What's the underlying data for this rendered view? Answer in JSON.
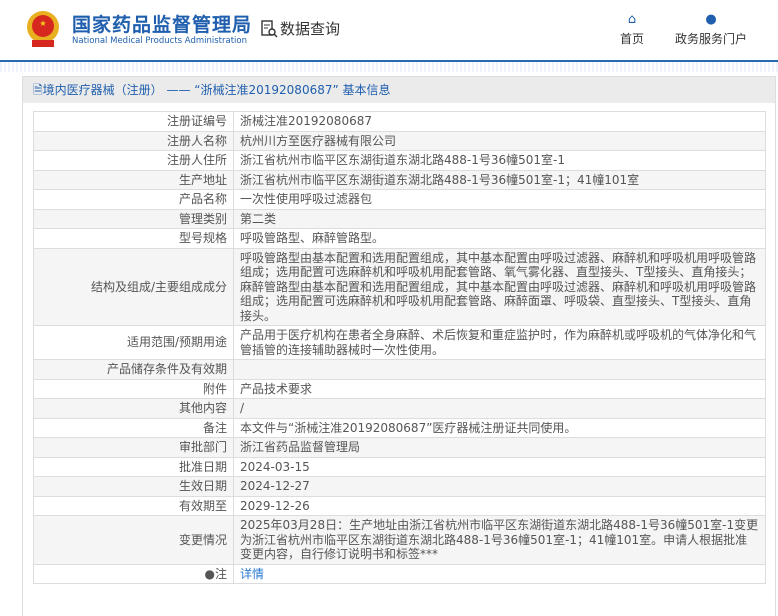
{
  "header": {
    "logo_cn": "国家药品监督管理局",
    "logo_en": "National Medical Products Administration",
    "query_label": "数据查询",
    "nav": [
      {
        "label": "首页",
        "icon": "home-icon"
      },
      {
        "label": "政务服务门户",
        "icon": "user-icon"
      }
    ]
  },
  "panel": {
    "title": "境内医疗器械（注册） —— “浙械注准20192080687” 基本信息"
  },
  "rows": [
    {
      "k": "注册证编号",
      "v": "浙械注准20192080687"
    },
    {
      "k": "注册人名称",
      "v": "杭州川方至医疗器械有限公司"
    },
    {
      "k": "注册人住所",
      "v": "浙江省杭州市临平区东湖街道东湖北路488-1号36幢501室-1"
    },
    {
      "k": "生产地址",
      "v": "浙江省杭州市临平区东湖街道东湖北路488-1号36幢501室-1；41幢101室"
    },
    {
      "k": "产品名称",
      "v": "一次性使用呼吸过滤器包"
    },
    {
      "k": "管理类别",
      "v": "第二类"
    },
    {
      "k": "型号规格",
      "v": "呼吸管路型、麻醉管路型。"
    },
    {
      "k": "结构及组成/主要组成成分",
      "v": "呼吸管路型由基本配置和选用配置组成，其中基本配置由呼吸过滤器、麻醉机和呼吸机用呼吸管路组成；选用配置可选麻醉机和呼吸机用配套管路、氧气雾化器、直型接头、T型接头、直角接头；麻醉管路型由基本配置和选用配置组成，其中基本配置由呼吸过滤器、麻醉机和呼吸机用呼吸管路组成；选用配置可选麻醉机和呼吸机用配套管路、麻醉面罩、呼吸袋、直型接头、T型接头、直角接头。"
    },
    {
      "k": "适用范围/预期用途",
      "v": "产品用于医疗机构在患者全身麻醉、术后恢复和重症监护时，作为麻醉机或呼吸机的气体净化和气管插管的连接辅助器械时一次性使用。"
    },
    {
      "k": "产品储存条件及有效期",
      "v": ""
    },
    {
      "k": "附件",
      "v": "产品技术要求"
    },
    {
      "k": "其他内容",
      "v": "/"
    },
    {
      "k": "备注",
      "v": "本文件与“浙械注准20192080687”医疗器械注册证共同使用。"
    },
    {
      "k": "审批部门",
      "v": "浙江省药品监督管理局"
    },
    {
      "k": "批准日期",
      "v": "2024-03-15"
    },
    {
      "k": "生效日期",
      "v": "2024-12-27"
    },
    {
      "k": "有效期至",
      "v": "2029-12-26"
    },
    {
      "k": "变更情况",
      "v": "2025年03月28日：生产地址由浙江省杭州市临平区东湖街道东湖北路488-1号36幢501室-1变更为浙江省杭州市临平区东湖街道东湖北路488-1号36幢501室-1；41幢101室。申请人根据批准变更内容，自行修订说明书和标签***"
    }
  ],
  "note": {
    "label": "注",
    "link": "详情"
  }
}
